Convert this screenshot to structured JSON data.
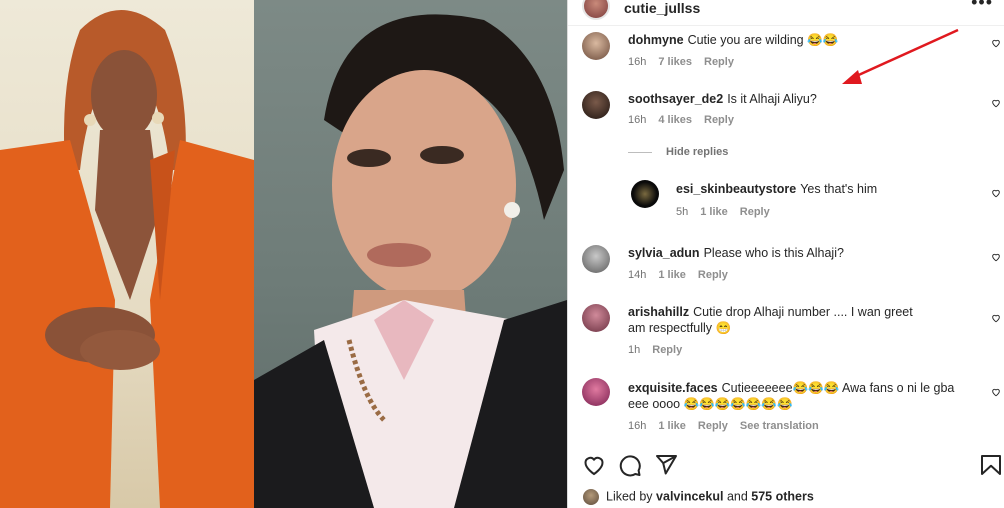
{
  "post": {
    "username": "cutie_jullss",
    "more_icon": "more-horizontal-icon"
  },
  "comments": [
    {
      "username": "dohmyne",
      "text": "Cutie you are wilding 😂😂",
      "time": "16h",
      "likes": "7 likes",
      "reply": "Reply"
    },
    {
      "username": "soothsayer_de2",
      "text": "Is it Alhaji Aliyu?",
      "time": "16h",
      "likes": "4 likes",
      "reply": "Reply"
    },
    {
      "username": "esi_skinbeautystore",
      "text": "Yes that's him",
      "time": "5h",
      "likes": "1 like",
      "reply": "Reply"
    },
    {
      "username": "sylvia_adun",
      "text": "Please who is this Alhaji?",
      "time": "14h",
      "likes": "1 like",
      "reply": "Reply"
    },
    {
      "username": "arishahillz",
      "text": "Cutie drop Alhaji number .... I wan greet am respectfully 😁",
      "time": "1h",
      "reply": "Reply"
    },
    {
      "username": "exquisite.faces",
      "text": "Cutieeeeeee😂😂😂 Awa fans o ni le gba eee oooo 😂😂😂😂😂😂😂",
      "time": "16h",
      "likes": "1 like",
      "reply": "Reply",
      "translation": "See translation"
    }
  ],
  "hide_replies_label": "Hide replies",
  "likes_summary": {
    "prefix": "Liked by",
    "user": "valvincekul",
    "middle": "and",
    "others": "575 others"
  },
  "icons": [
    "heart-icon",
    "comment-icon",
    "share-icon",
    "bookmark-icon"
  ],
  "colors": {
    "arrow": "#e0191f",
    "blazer_orange": "#e2611c",
    "blazer_black": "#1b1b1d",
    "muted_text": "#737373"
  }
}
